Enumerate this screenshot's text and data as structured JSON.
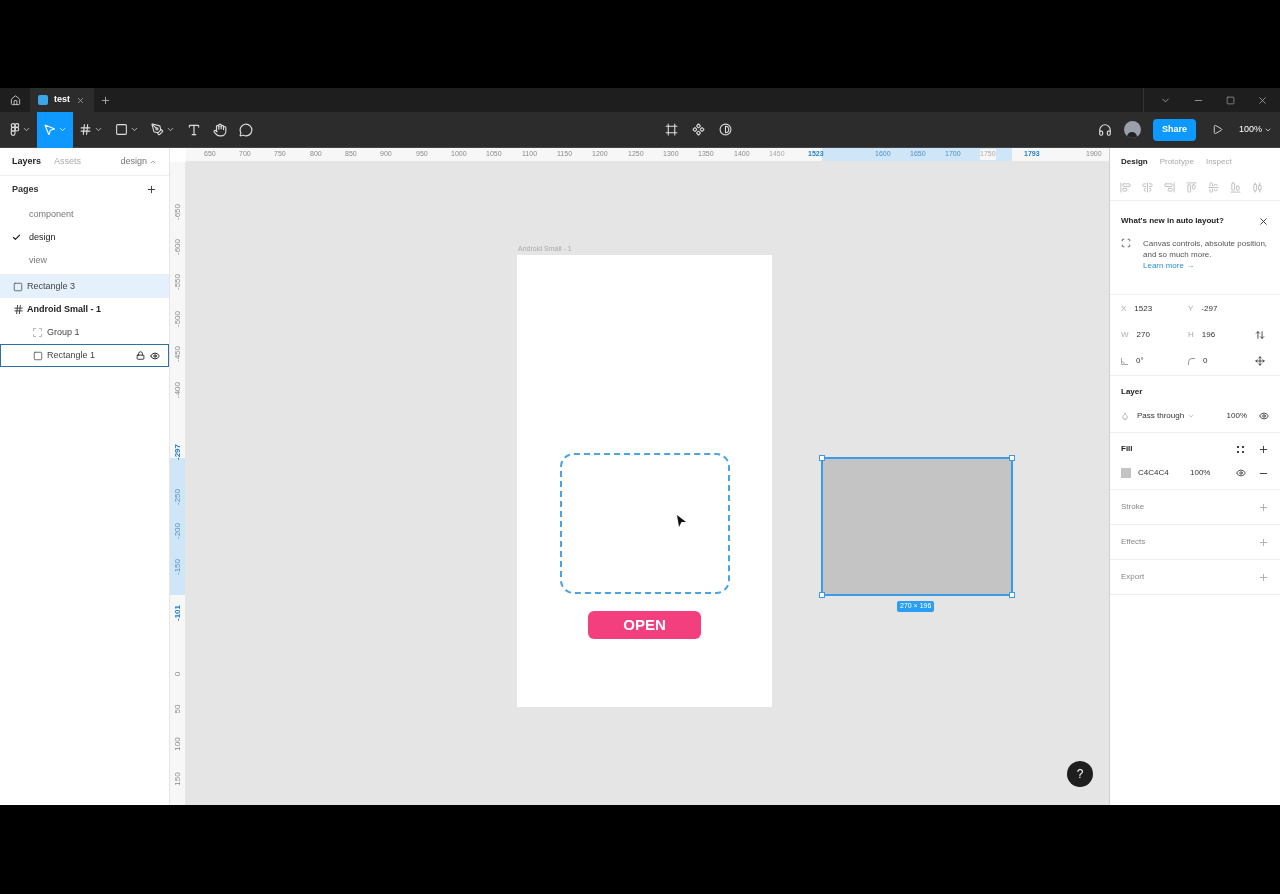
{
  "file_tab": {
    "title": "test",
    "selected": true
  },
  "toolbar": {
    "zoom": "100%",
    "share": "Share",
    "tools": [
      {
        "kind": "menu",
        "selected": false
      },
      {
        "kind": "move",
        "selected": true
      },
      {
        "kind": "frame",
        "selected": false
      },
      {
        "kind": "shape",
        "selected": false
      },
      {
        "kind": "pen",
        "selected": false
      },
      {
        "kind": "text",
        "selected": false
      },
      {
        "kind": "hand",
        "selected": false
      },
      {
        "kind": "comment",
        "selected": false
      }
    ]
  },
  "left_panel": {
    "tabs": [
      {
        "label": "Layers",
        "selected": true
      },
      {
        "label": "Assets",
        "selected": false
      }
    ],
    "page_switch": "design",
    "pages_title": "Pages",
    "pages": [
      {
        "label": "component",
        "selected": false
      },
      {
        "label": "design",
        "selected": true
      },
      {
        "label": "view",
        "selected": false
      }
    ],
    "layers": [
      {
        "label": "Rectangle 3",
        "kind": "rectangle",
        "selected": true,
        "hovered": false
      },
      {
        "label": "Android Small - 1",
        "kind": "frame",
        "selected": false,
        "hovered": false,
        "children": [
          {
            "label": "Group 1",
            "kind": "group",
            "selected": false,
            "hovered": false
          },
          {
            "label": "Rectangle 1",
            "kind": "rectangle",
            "selected": false,
            "hovered": true
          }
        ]
      }
    ]
  },
  "top_ruler": [
    {
      "label": "650",
      "kind": "normal"
    },
    {
      "label": "700",
      "kind": "normal"
    },
    {
      "label": "750",
      "kind": "normal"
    },
    {
      "label": "800",
      "kind": "normal"
    },
    {
      "label": "850",
      "kind": "normal"
    },
    {
      "label": "900",
      "kind": "normal"
    },
    {
      "label": "950",
      "kind": "normal"
    },
    {
      "label": "1000",
      "kind": "normal"
    },
    {
      "label": "1050",
      "kind": "normal"
    },
    {
      "label": "1100",
      "kind": "normal"
    },
    {
      "label": "1150",
      "kind": "normal"
    },
    {
      "label": "1200",
      "kind": "normal"
    },
    {
      "label": "1250",
      "kind": "normal"
    },
    {
      "label": "1300",
      "kind": "normal"
    },
    {
      "label": "1350",
      "kind": "normal"
    },
    {
      "label": "1400",
      "kind": "normal"
    },
    {
      "label": "1450",
      "kind": "faint"
    },
    {
      "label": "1523",
      "kind": "selected"
    },
    {
      "label": "1600",
      "kind": "inside"
    },
    {
      "label": "1650",
      "kind": "inside"
    },
    {
      "label": "1700",
      "kind": "inside"
    },
    {
      "label": "1750",
      "kind": "faint"
    },
    {
      "label": "1793",
      "kind": "selected"
    },
    {
      "label": "1900",
      "kind": "normal"
    }
  ],
  "left_ruler": [
    {
      "label": "-650",
      "kind": "normal"
    },
    {
      "label": "-600",
      "kind": "normal"
    },
    {
      "label": "-550",
      "kind": "normal"
    },
    {
      "label": "-500",
      "kind": "normal"
    },
    {
      "label": "-450",
      "kind": "normal"
    },
    {
      "label": "-400",
      "kind": "normal"
    },
    {
      "label": "-297",
      "kind": "selected"
    },
    {
      "label": "-250",
      "kind": "inside"
    },
    {
      "label": "-200",
      "kind": "inside"
    },
    {
      "label": "-150",
      "kind": "inside"
    },
    {
      "label": "-101",
      "kind": "selected"
    },
    {
      "label": "0",
      "kind": "normal"
    },
    {
      "label": "50",
      "kind": "normal"
    },
    {
      "label": "100",
      "kind": "normal"
    },
    {
      "label": "150",
      "kind": "normal"
    }
  ],
  "canvas": {
    "frame": {
      "title": "Android Small - 1",
      "button": "OPEN"
    },
    "selection_size": "270 × 196",
    "help": "?"
  },
  "right_panel": {
    "tabs": [
      {
        "label": "Design",
        "selected": true
      },
      {
        "label": "Prototype",
        "selected": false
      },
      {
        "label": "Inspect",
        "selected": false
      }
    ],
    "notice": {
      "title": "What's new in auto layout?",
      "text": "Canvas controls, absolute position, and so much more.",
      "link": "Learn more →"
    },
    "properties": [
      {
        "label": "X",
        "value": "1523"
      },
      {
        "label": "Y",
        "value": "-297"
      },
      {
        "label": "W",
        "value": "270"
      },
      {
        "label": "H",
        "value": "196"
      }
    ],
    "rotation": "0°",
    "radius": "0",
    "layer": {
      "title": "Layer",
      "blend": "Pass through",
      "opacity": "100%"
    },
    "fill": {
      "title": "Fill",
      "color": "#c4c4c4",
      "hex": "C4C4C4",
      "opacity": "100%"
    },
    "sections": [
      "Stroke",
      "Effects",
      "Export"
    ]
  }
}
